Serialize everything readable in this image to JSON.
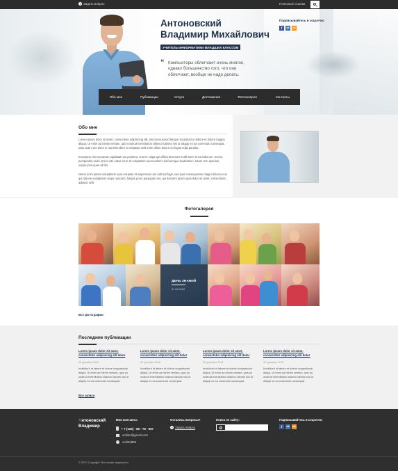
{
  "topbar": {
    "ask_label": "Задать вопрос",
    "links_label": "Полезные ссылки"
  },
  "hero": {
    "name_line1": "Антоновский",
    "name_line2": "Владимир Михайлович",
    "title": "УЧИТЕЛЬ ИНФОРМАТИКИ МЛАДШИХ КЛАССОВ",
    "quote_line1": "Компьютеры облегчают очень многое,",
    "quote_line2": "однако большинство того, что они",
    "quote_line3": "облегчают, вообще не надо делать.",
    "subscribe_label": "Подписывайтесь в соцсетях:",
    "social": [
      {
        "label": "f",
        "color": "#3b5998"
      },
      {
        "label": "vk",
        "color": "#4c75a3"
      },
      {
        "label": "ok",
        "color": "#f7931e"
      }
    ]
  },
  "nav": {
    "items": [
      "Обо мне",
      "Публикации",
      "Услуги",
      "Достижения",
      "Фотогалерея",
      "Контакты"
    ]
  },
  "about": {
    "heading": "Обо мне",
    "para1": "Lorem ipsum dolor sit amet, consectetur adipisicing elit, sed do eiusmod tempor incididunt ut labore et dolore magna aliqua. Ut enim ad minim veniam, quis nostrud exercitation ullamco laboris nisi ut aliquip ex ea commodo consequat. Duis aute irure dolor in reprehenderit in voluptate velit esse cillum dolore eu fugiat nulla pariatur.",
    "para2": "Excepteur sint occaecat cupidatat non proident, sunt in culpa qui officia deserunt mollit anim id est laborum. Sed ut perspiciatis unde omnis iste natus error sit voluptatem accusantium doloremque laudantium, totam rem aperiam, eaque ipsa quae ab illo.",
    "para3": "Nemo enim ipsam voluptatem quia voluptas sit aspernatur aut odit aut fugit, sed quia consequuntur magni dolores eos qui ratione voluptatem sequi nesciunt. Neque porro quisquam est, qui dolorem ipsum quia dolor sit amet, consectetur, adipisci velit."
  },
  "gallery": {
    "heading": "Фотогалерея",
    "feature_title": "ДЕНЬ ЗНАНИЙ",
    "feature_date": "01.09.2018",
    "all_label": "Все фотографии"
  },
  "publications": {
    "heading": "Последние публикации",
    "items": [
      {
        "title": "Lorem ipsum dolor sit amet, consectetur adipisicing elit dolor",
        "date": "20 декабря 2018",
        "excerpt": "Incididunt ut labore et dolore magnaloook aliqua. Ut enim ad minim veniam, quis po nostrud exercitation ullamco laboris nisi ut aliquip ex ea commodo consequat."
      },
      {
        "title": "Lorem ipsum dolor sit amet, consectetur adipisicing elit dolor",
        "date": "20 декабря 2018",
        "excerpt": "Incididunt ut labore et dolore magnaloook aliqua. Ut enim ad minim veniam, quis po nostrud exercitation ullamco laboris nisi ut aliquip ex ea commodo consequat."
      },
      {
        "title": "Lorem ipsum dolor sit amet, consectetur adipisicing elit dolor",
        "date": "20 декабря 2018",
        "excerpt": "Incididunt ut labore et dolore magnaloook aliqua. Ut enim ad minim veniam, quis po nostrud exercitation ullamco laboris nisi ut aliquip ex ea commodo consequat."
      },
      {
        "title": "Lorem ipsum dolor sit amet, consectetur adipisicing elit dolor",
        "date": "20 декабря 2018",
        "excerpt": "Incididunt ut labore et dolore magnaloook aliqua. Ut enim ad minim veniam, quis po nostrud exercitation ullamco laboris nisi ut aliquip ex ea commodo consequat."
      }
    ],
    "all_label": "Все записи"
  },
  "footer": {
    "logo_first_letter": "А",
    "logo_rest": "нтоновский",
    "logo_line2": "Владимир",
    "contacts_heading": "Мои контакты:",
    "phone": "+ 7 (104) - 56 - 78 - 597",
    "email": "uchitel@gmail.com",
    "skype": "uchitel888",
    "questions_heading": "Остались вопросы?",
    "ask_label": "Задать вопрос",
    "search_heading": "Поиск по сайту:",
    "subscribe_heading": "Подписывайтесь в соцсетях:",
    "copyright": "© 2017 Copyright. Все права защищены."
  }
}
